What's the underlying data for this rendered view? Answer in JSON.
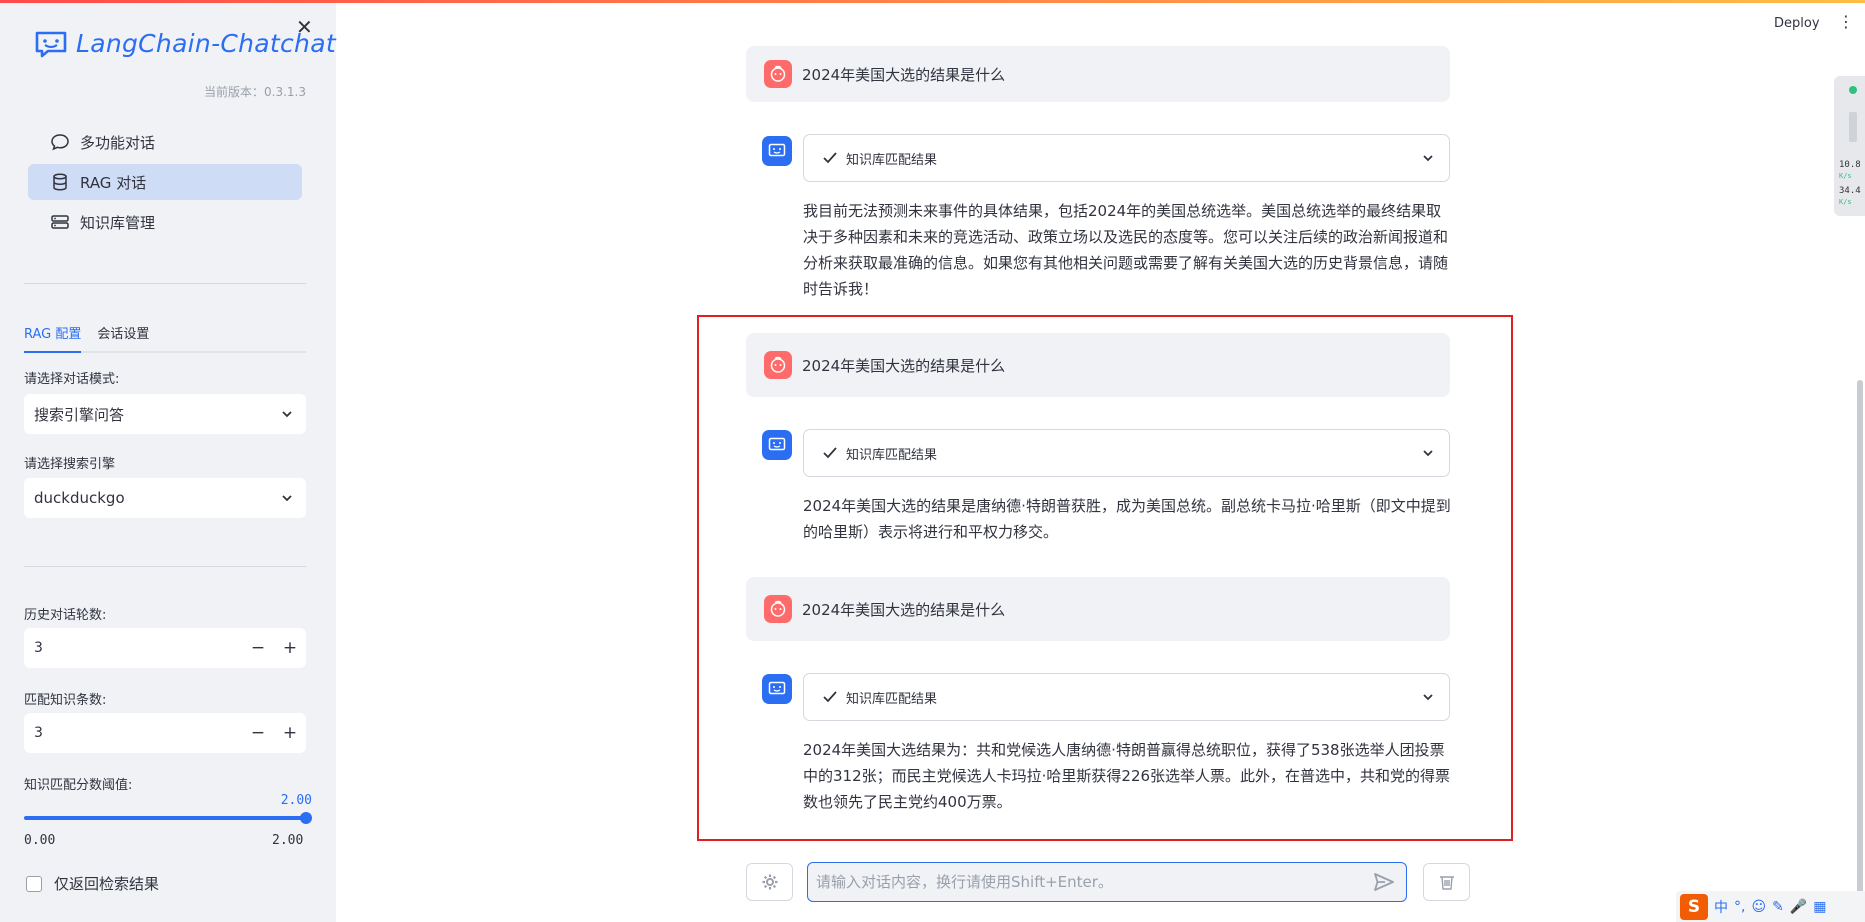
{
  "app": {
    "logo_text": "LangChain-Chatchat",
    "version": "当前版本：0.3.1.3",
    "deploy_label": "Deploy"
  },
  "sidebar": {
    "nav": [
      {
        "label": "多功能对话",
        "icon": "chat-bubble-icon",
        "active": false
      },
      {
        "label": "RAG 对话",
        "icon": "database-icon",
        "active": true
      },
      {
        "label": "知识库管理",
        "icon": "server-icon",
        "active": false
      }
    ],
    "tabs": [
      {
        "label": "RAG 配置",
        "active": true
      },
      {
        "label": "会话设置",
        "active": false
      }
    ],
    "mode_label": "请选择对话模式:",
    "mode_value": "搜索引擎问答",
    "engine_label": "请选择搜索引擎",
    "engine_value": "duckduckgo",
    "history_label": "历史对话轮数:",
    "history_value": "3",
    "match_label": "匹配知识条数:",
    "match_value": "3",
    "threshold_label": "知识匹配分数阈值:",
    "threshold_value": "2.00",
    "threshold_min": "0.00",
    "threshold_max": "2.00",
    "threshold_fraction": 1.0,
    "only_retrieval_label": "仅返回检索结果"
  },
  "chat": {
    "messages": [
      {
        "question": "2024年美国大选的结果是什么",
        "expander_label": "知识库匹配结果",
        "answer": "我目前无法预测未来事件的具体结果，包括2024年的美国总统选举。美国总统选举的最终结果取决于多种因素和未来的竞选活动、政策立场以及选民的态度等。您可以关注后续的政治新闻报道和分析来获取最准确的信息。如果您有其他相关问题或需要了解有关美国大选的历史背景信息，请随时告诉我！"
      },
      {
        "question": "2024年美国大选的结果是什么",
        "expander_label": "知识库匹配结果",
        "answer": "2024年美国大选的结果是唐纳德·特朗普获胜，成为美国总统。副总统卡马拉·哈里斯（即文中提到的哈里斯）表示将进行和平权力移交。"
      },
      {
        "question": "2024年美国大选的结果是什么",
        "expander_label": "知识库匹配结果",
        "answer": "2024年美国大选结果为：共和党候选人唐纳德·特朗普赢得总统职位，获得了538张选举人团投票中的312张；而民主党候选人卡玛拉·哈里斯获得226张选举人票。此外，在普选中，共和党的得票数也领先了民主党约400万票。"
      }
    ],
    "input_placeholder": "请输入对话内容，换行请使用Shift+Enter。"
  },
  "netwidget": {
    "upload": "10.8",
    "upload_unit": "K/s",
    "download": "34.4",
    "download_unit": "K/s"
  },
  "ime": {
    "logo": "S",
    "items": [
      "中",
      "°,",
      "☺",
      "✎",
      "🎤",
      "▦"
    ]
  },
  "colors": {
    "accent": "#2b6ef2",
    "sidebar_bg": "#f0f2f6",
    "user_avatar": "#ff6b6b",
    "highlight_border": "#e02020"
  }
}
